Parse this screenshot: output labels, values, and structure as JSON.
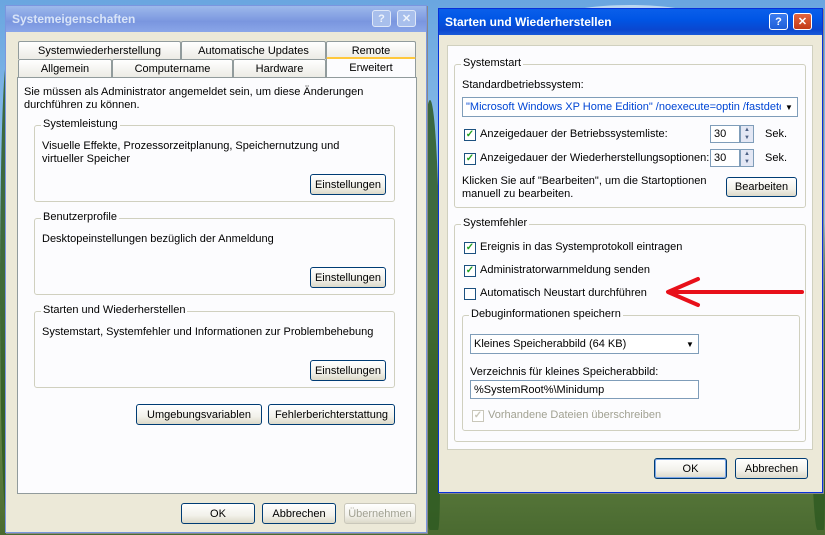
{
  "sysprops": {
    "title": "Systemeigenschaften",
    "tabs_row1": [
      "Systemwiederherstellung",
      "Automatische Updates",
      "Remote"
    ],
    "tabs_row2": [
      "Allgemein",
      "Computername",
      "Hardware",
      "Erweitert"
    ],
    "admin_note": "Sie müssen als Administrator angemeldet sein, um diese Änderungen durchführen zu können.",
    "perf": {
      "title": "Systemleistung",
      "desc": "Visuelle Effekte, Prozessorzeitplanung, Speichernutzung und virtueller Speicher",
      "btn": "Einstellungen"
    },
    "profiles": {
      "title": "Benutzerprofile",
      "desc": "Desktopeinstellungen bezüglich der Anmeldung",
      "btn": "Einstellungen"
    },
    "startup": {
      "title": "Starten und Wiederherstellen",
      "desc": "Systemstart, Systemfehler und Informationen zur Problembehebung",
      "btn": "Einstellungen"
    },
    "env_btn": "Umgebungsvariablen",
    "err_btn": "Fehlerberichterstattung",
    "ok": "OK",
    "cancel": "Abbrechen",
    "apply": "Übernehmen"
  },
  "startrec": {
    "title": "Starten und Wiederherstellen",
    "systemstart": {
      "title": "Systemstart",
      "default_os_label": "Standardbetriebssystem:",
      "default_os_value": "\"Microsoft Windows XP Home Edition\" /noexecute=optin /fastdetect",
      "os_list_label": "Anzeigedauer der Betriebssystemliste:",
      "os_list_value": "30",
      "recovery_label": "Anzeigedauer der Wiederherstellungsoptionen:",
      "recovery_value": "30",
      "unit": "Sek.",
      "edit_hint": "Klicken Sie auf \"Bearbeiten\", um die Startoptionen manuell zu bearbeiten.",
      "edit_btn": "Bearbeiten"
    },
    "systemfehler": {
      "title": "Systemfehler",
      "log_label": "Ereignis in das Systemprotokoll eintragen",
      "alert_label": "Administratorwarnmeldung senden",
      "restart_label": "Automatisch Neustart durchführen",
      "debug": {
        "title": "Debuginformationen speichern",
        "type_value": "Kleines Speicherabbild (64 KB)",
        "dir_label": "Verzeichnis für kleines Speicherabbild:",
        "dir_value": "%SystemRoot%\\Minidump",
        "overwrite_label": "Vorhandene Dateien überschreiben"
      }
    },
    "ok": "OK",
    "cancel": "Abbrechen"
  },
  "checks": {
    "log": true,
    "alert": true,
    "restart": false,
    "overwrite": true
  },
  "colors": {
    "arrow": "#e8101a",
    "title_active": "#0055e5",
    "group_title": "#0046d5"
  },
  "icons": {
    "help": "?",
    "close": "✕",
    "check": "✓",
    "dropdown": "▼",
    "up": "▲",
    "down": "▼"
  }
}
